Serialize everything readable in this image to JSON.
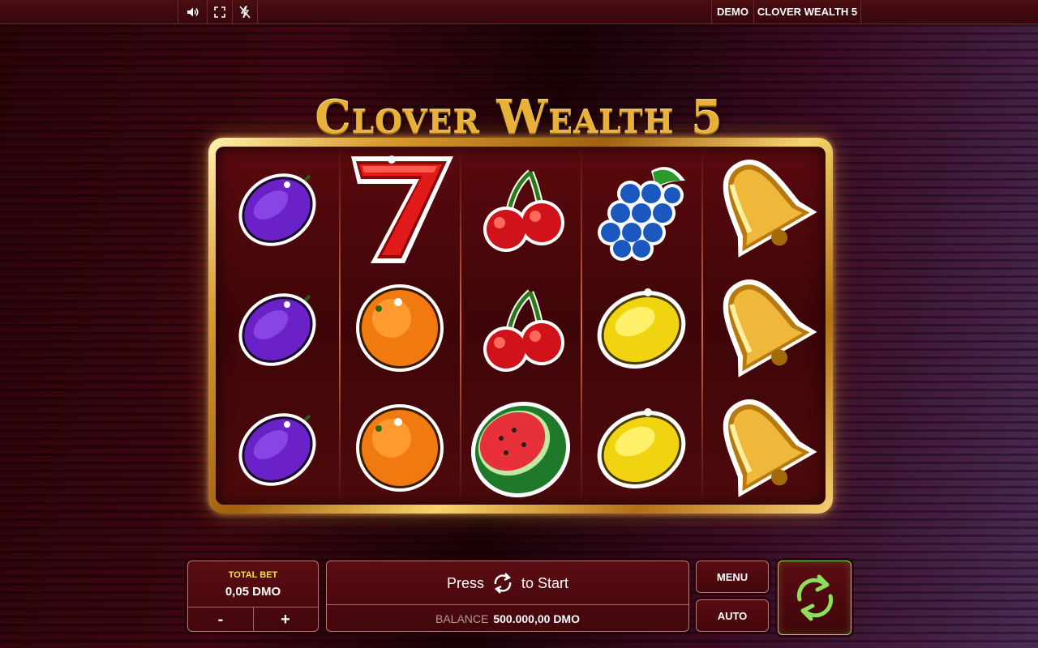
{
  "topbar": {
    "sound_icon": "speaker-icon",
    "fullscreen_icon": "fullscreen-icon",
    "turbo_icon": "turbo-off-icon",
    "mode_label": "DEMO",
    "game_title": "CLOVER WEALTH 5"
  },
  "logo": {
    "text": "Clover Wealth 5"
  },
  "reels": {
    "columns": [
      [
        "plum",
        "plum",
        "plum"
      ],
      [
        "seven",
        "orange",
        "orange"
      ],
      [
        "cherry",
        "cherry",
        "watermelon"
      ],
      [
        "grapes",
        "lemon",
        "lemon"
      ],
      [
        "bell",
        "bell",
        "bell"
      ]
    ]
  },
  "bet": {
    "title": "TOTAL BET",
    "value": "0,05 DMO",
    "minus_label": "-",
    "plus_label": "+"
  },
  "message": {
    "prefix": "Press",
    "icon": "spin-arrows-icon",
    "suffix": "to Start"
  },
  "balance": {
    "label": "BALANCE",
    "value": "500.000,00 DMO"
  },
  "buttons": {
    "menu_label": "MENU",
    "auto_label": "AUTO",
    "spin_icon": "spin-arrows-icon"
  },
  "colors": {
    "accent_gold": "#e8b13a",
    "bet_title": "#f5e24a",
    "spin_green": "#8ce05a"
  }
}
